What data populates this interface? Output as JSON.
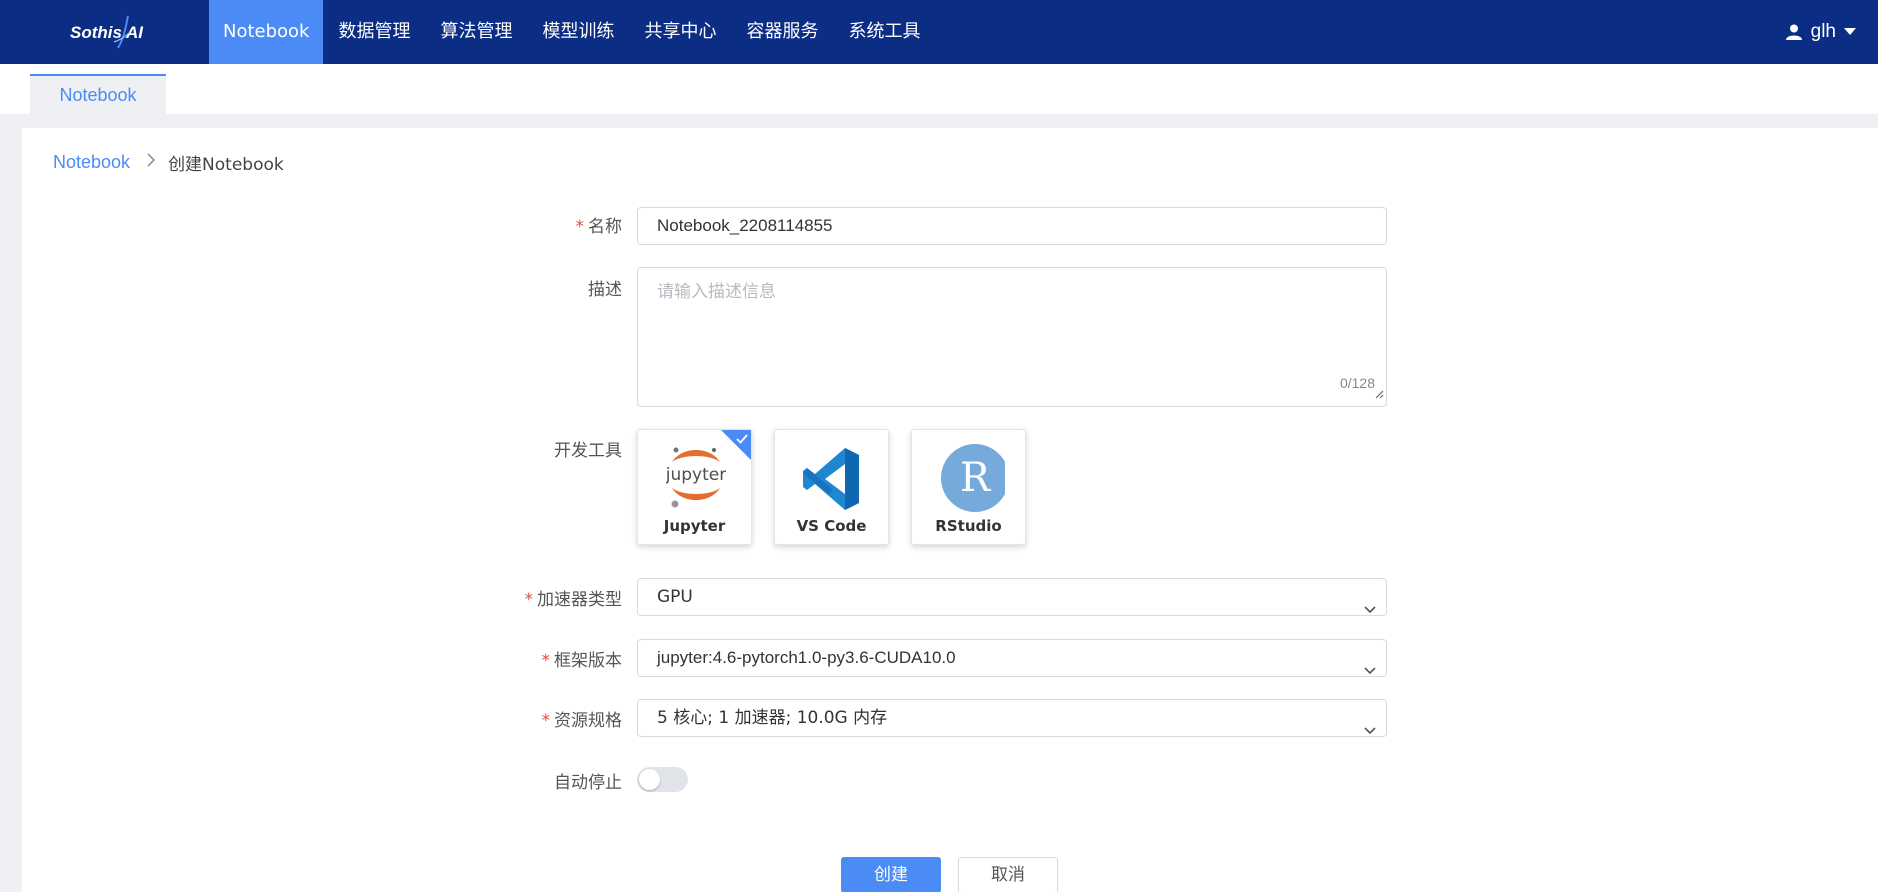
{
  "brand": {
    "logo_text": "Sothis AI"
  },
  "nav": {
    "items": [
      {
        "label": "Notebook",
        "active": true
      },
      {
        "label": "数据管理"
      },
      {
        "label": "算法管理"
      },
      {
        "label": "模型训练"
      },
      {
        "label": "共享中心"
      },
      {
        "label": "容器服务"
      },
      {
        "label": "系统工具"
      }
    ],
    "user": "glh"
  },
  "tabs": [
    {
      "label": "Notebook"
    }
  ],
  "breadcrumb": {
    "parent": "Notebook",
    "current": "创建Notebook"
  },
  "form": {
    "name": {
      "label": "名称",
      "required": "*",
      "value": "Notebook_2208114855"
    },
    "description": {
      "label": "描述",
      "placeholder": "请输入描述信息",
      "counter": "0/128"
    },
    "dev_tools": {
      "label": "开发工具",
      "options": [
        {
          "name": "Jupyter",
          "icon": "jupyter-icon",
          "selected": true
        },
        {
          "name": "VS Code",
          "icon": "vscode-icon",
          "selected": false
        },
        {
          "name": "RStudio",
          "icon": "rstudio-icon",
          "selected": false
        }
      ]
    },
    "accelerator": {
      "label": "加速器类型",
      "required": "*",
      "value": "GPU"
    },
    "framework": {
      "label": "框架版本",
      "required": "*",
      "value": "jupyter:4.6-pytorch1.0-py3.6-CUDA10.0"
    },
    "resource": {
      "label": "资源规格",
      "required": "*",
      "value": "5 核心; 1 加速器; 10.0G 内存"
    },
    "auto_stop": {
      "label": "自动停止",
      "enabled": false
    }
  },
  "actions": {
    "create": "创建",
    "cancel": "取消"
  },
  "colors": {
    "nav_bg": "#0b2d84",
    "accent": "#4a8bf5",
    "required": "#f0483e"
  }
}
